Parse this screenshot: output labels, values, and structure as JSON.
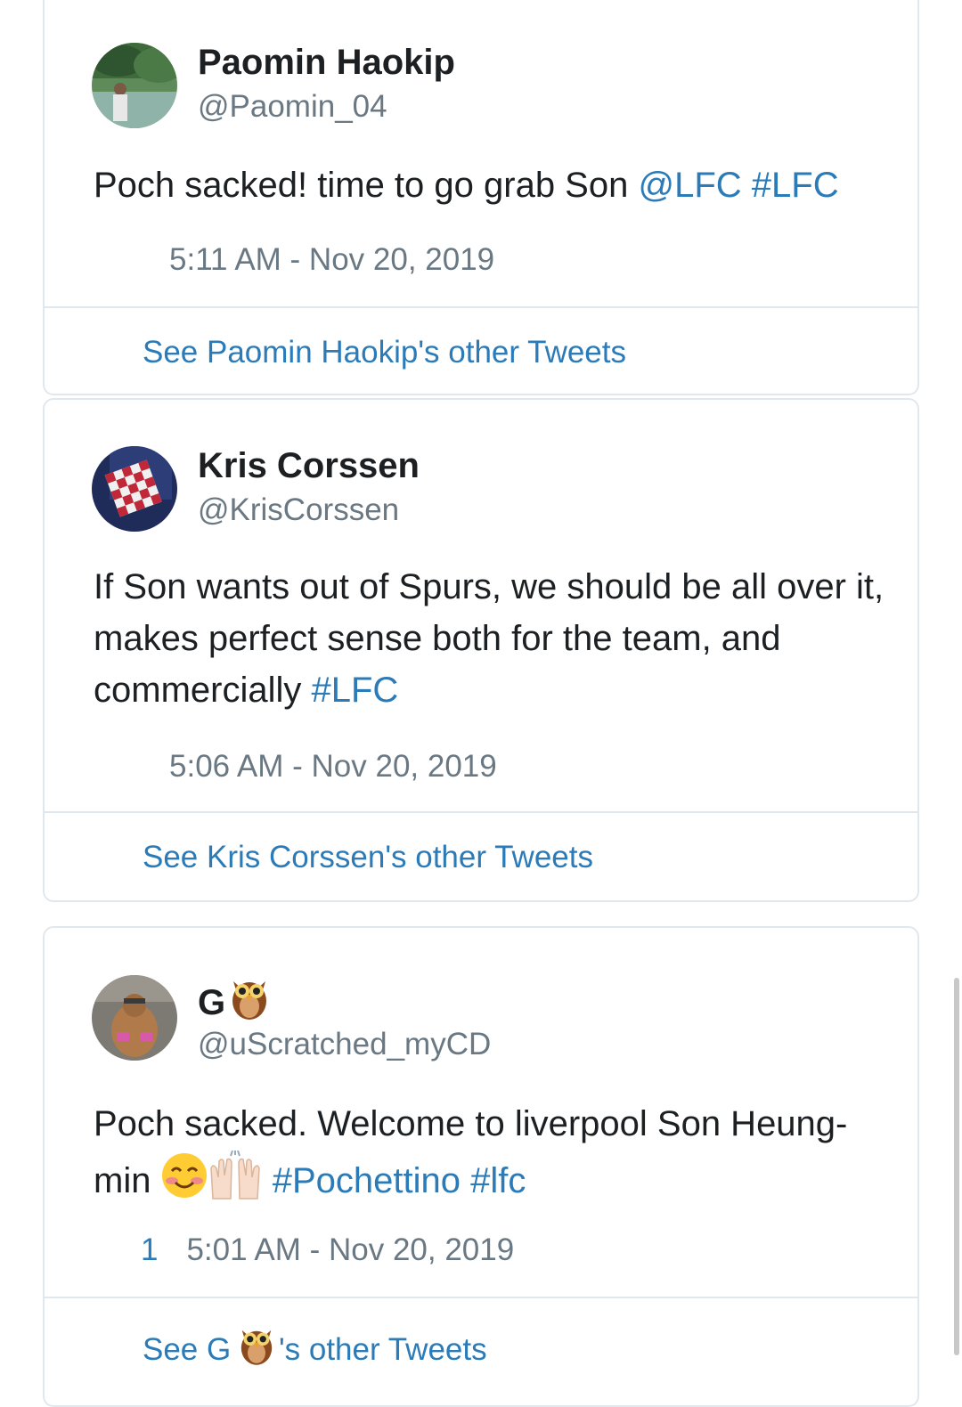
{
  "tweets": [
    {
      "name": "Paomin Haokip",
      "handle": "@Paomin_04",
      "text": "Poch sacked! time to go grab Son ",
      "mention": "@LFC",
      "hashtag": "#LFC",
      "time": "5:11 AM - Nov 20, 2019",
      "footer": "See Paomin Haokip's other Tweets"
    },
    {
      "name": "Kris Corssen",
      "handle": "@KrisCorssen",
      "text": "If Son wants out of Spurs, we should be all over it, makes perfect sense both for the team, and commercially ",
      "hashtag": "#LFC",
      "time": "5:06 AM - Nov 20, 2019",
      "footer": "See Kris Corssen's other Tweets"
    },
    {
      "name": "G",
      "name_emoji": "owl-emoji",
      "handle": "@uScratched_myCD",
      "text": "Poch sacked. Welcome to liverpool Son Heung-min ",
      "text_emojis": [
        "smiling-face-emoji",
        "raising-hands-emoji"
      ],
      "hashtag1": "#Pochettino",
      "hashtag2": "#lfc",
      "likes": "1",
      "time": "5:01 AM - Nov 20, 2019",
      "footer_prefix": "See G ",
      "footer_suffix": "'s other Tweets"
    }
  ],
  "colors": {
    "link": "#2b7bb9",
    "muted": "#697882",
    "text": "#1c2022",
    "border": "#e1e8ed"
  }
}
